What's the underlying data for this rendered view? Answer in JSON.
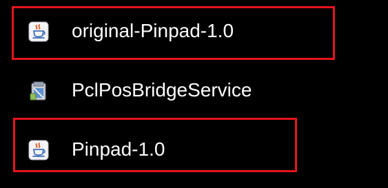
{
  "files": [
    {
      "name": "original-Pinpad-1.0",
      "icon": "java-jar-icon",
      "highlighted": true
    },
    {
      "name": "PclPosBridgeService",
      "icon": "installer-package-icon",
      "highlighted": false
    },
    {
      "name": "Pinpad-1.0",
      "icon": "java-jar-icon",
      "highlighted": true
    }
  ],
  "colors": {
    "background": "#000000",
    "text": "#ffffff",
    "highlight_border": "#e8141c"
  }
}
